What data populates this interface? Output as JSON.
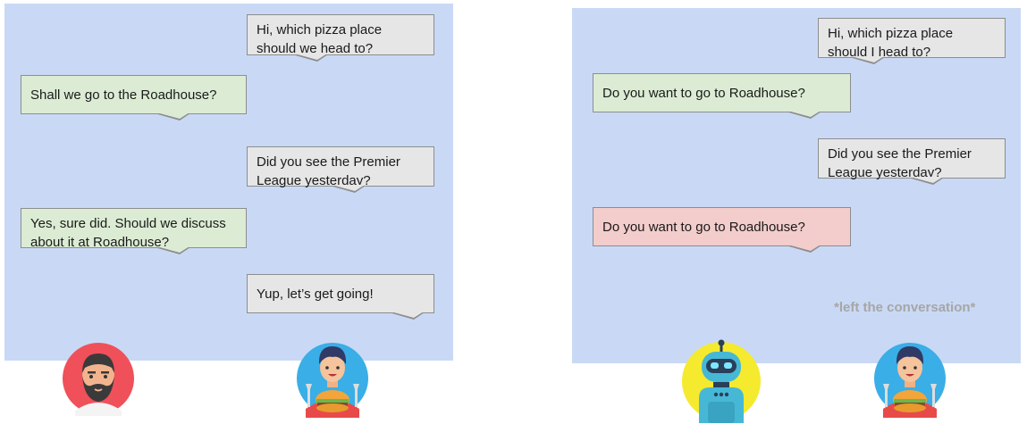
{
  "left_conversation": {
    "messages": [
      {
        "speaker": "user",
        "text_lines": [
          "Hi, which pizza place",
          "should we head to?"
        ]
      },
      {
        "speaker": "friend",
        "text_lines": [
          "Shall we go to the Roadhouse?"
        ]
      },
      {
        "speaker": "user",
        "text_lines": [
          "Did you see the Premier",
          "League yesterday?"
        ]
      },
      {
        "speaker": "friend",
        "text_lines": [
          "Yes, sure did. Should we discuss",
          "about it at Roadhouse?"
        ]
      },
      {
        "speaker": "user",
        "text_lines": [
          "Yup, let’s get going!"
        ]
      }
    ]
  },
  "right_conversation": {
    "messages": [
      {
        "speaker": "user",
        "text_lines": [
          "Hi, which pizza place",
          "should I head to?"
        ]
      },
      {
        "speaker": "bot",
        "text_lines": [
          "Do you want to go to Roadhouse?"
        ]
      },
      {
        "speaker": "user",
        "text_lines": [
          "Did you see the Premier",
          "League yesterday?"
        ]
      },
      {
        "speaker": "bot",
        "text_lines": [
          "Do you want to go to Roadhouse?"
        ]
      }
    ],
    "note": "*left the conversation*"
  },
  "avatars": {
    "left": [
      "bearded-man-icon",
      "pizza-eater-icon"
    ],
    "right": [
      "robot-icon",
      "pizza-eater-icon"
    ]
  },
  "colors": {
    "panel": "#c9d9f5",
    "user_bubble": "#e6e6e6",
    "friend_bubble": "#dcecd4",
    "bot_bad_bubble": "#f3cccc",
    "note_text": "#a6a6a6"
  }
}
